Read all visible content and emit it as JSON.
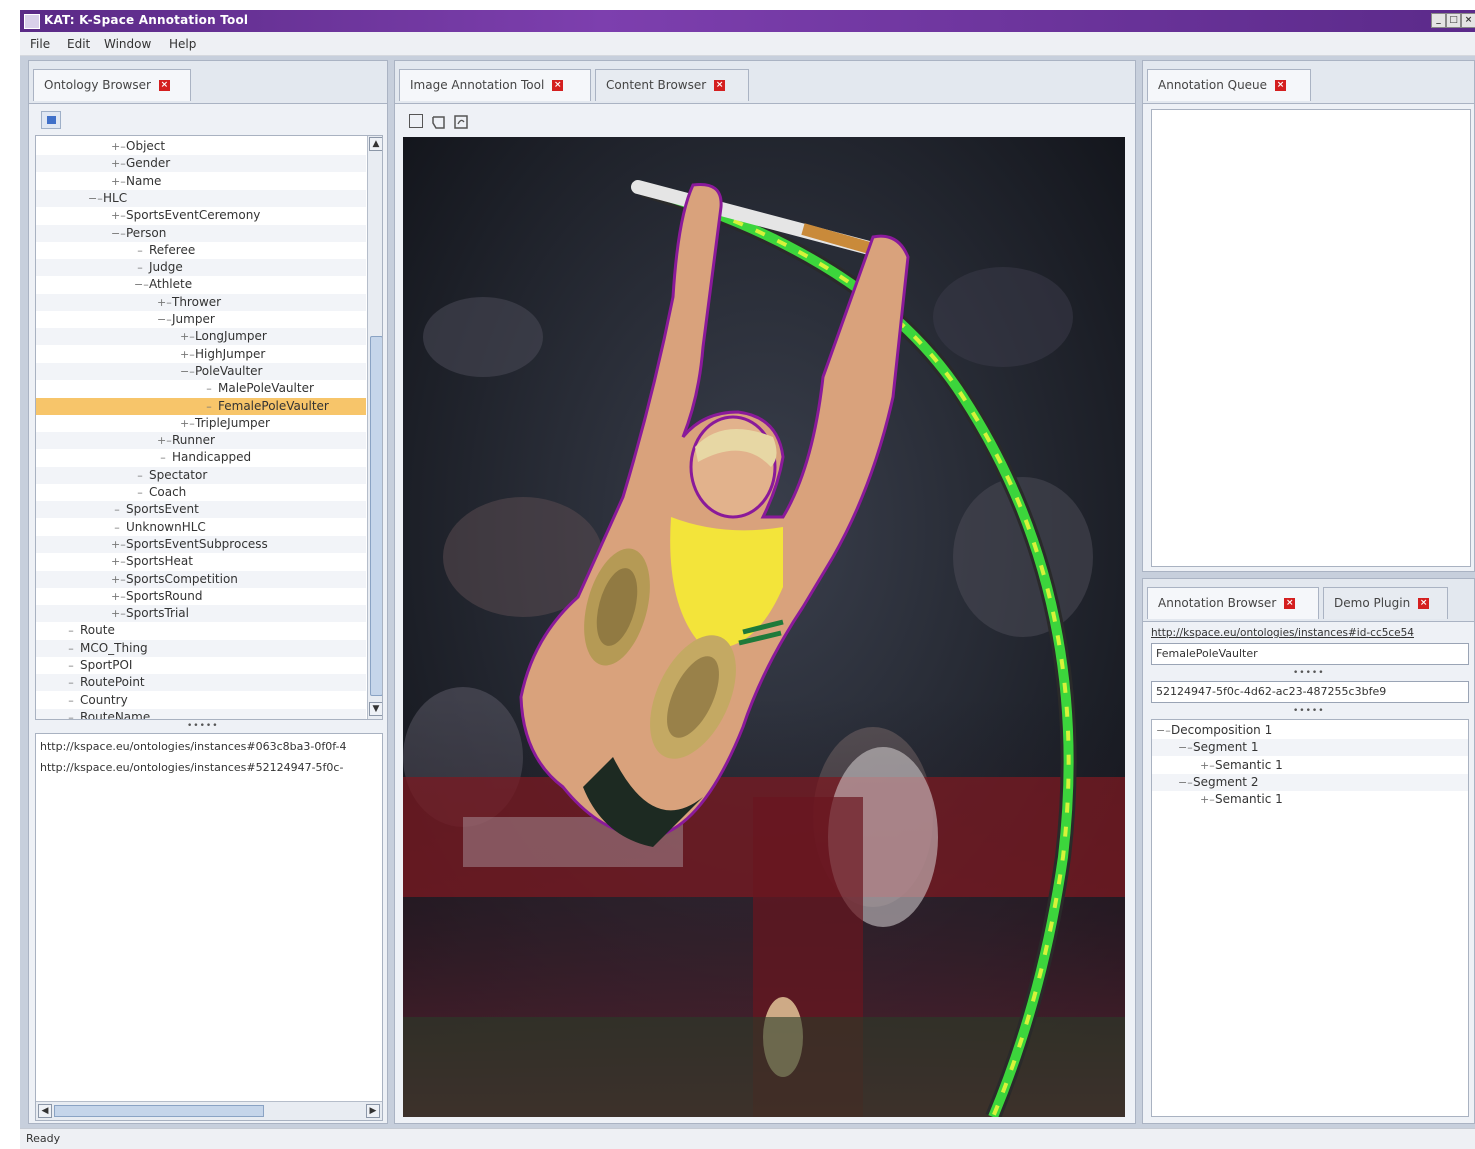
{
  "window": {
    "title": "KAT: K-Space Annotation Tool"
  },
  "menu": [
    "File",
    "Edit",
    "Window",
    "Help"
  ],
  "left_panel": {
    "tab_label": "Ontology Browser",
    "tree": [
      {
        "label": "Object",
        "depth": 3,
        "toggle": "+"
      },
      {
        "label": "Gender",
        "depth": 3,
        "toggle": "+"
      },
      {
        "label": "Name",
        "depth": 3,
        "toggle": "+"
      },
      {
        "label": "HLC",
        "depth": 2,
        "toggle": "−"
      },
      {
        "label": "SportsEventCeremony",
        "depth": 3,
        "toggle": "+"
      },
      {
        "label": "Person",
        "depth": 3,
        "toggle": "−"
      },
      {
        "label": "Referee",
        "depth": 4,
        "toggle": ""
      },
      {
        "label": "Judge",
        "depth": 4,
        "toggle": ""
      },
      {
        "label": "Athlete",
        "depth": 4,
        "toggle": "−"
      },
      {
        "label": "Thrower",
        "depth": 5,
        "toggle": "+"
      },
      {
        "label": "Jumper",
        "depth": 5,
        "toggle": "−"
      },
      {
        "label": "LongJumper",
        "depth": 6,
        "toggle": "+"
      },
      {
        "label": "HighJumper",
        "depth": 6,
        "toggle": "+"
      },
      {
        "label": "PoleVaulter",
        "depth": 6,
        "toggle": "−"
      },
      {
        "label": "MalePoleVaulter",
        "depth": 7,
        "toggle": ""
      },
      {
        "label": "FemalePoleVaulter",
        "depth": 7,
        "toggle": "",
        "selected": true
      },
      {
        "label": "TripleJumper",
        "depth": 6,
        "toggle": "+"
      },
      {
        "label": "Runner",
        "depth": 5,
        "toggle": "+"
      },
      {
        "label": "Handicapped",
        "depth": 5,
        "toggle": ""
      },
      {
        "label": "Spectator",
        "depth": 4,
        "toggle": ""
      },
      {
        "label": "Coach",
        "depth": 4,
        "toggle": ""
      },
      {
        "label": "SportsEvent",
        "depth": 3,
        "toggle": ""
      },
      {
        "label": "UnknownHLC",
        "depth": 3,
        "toggle": ""
      },
      {
        "label": "SportsEventSubprocess",
        "depth": 3,
        "toggle": "+"
      },
      {
        "label": "SportsHeat",
        "depth": 3,
        "toggle": "+"
      },
      {
        "label": "SportsCompetition",
        "depth": 3,
        "toggle": "+"
      },
      {
        "label": "SportsRound",
        "depth": 3,
        "toggle": "+"
      },
      {
        "label": "SportsTrial",
        "depth": 3,
        "toggle": "+"
      },
      {
        "label": "Route",
        "depth": 1,
        "toggle": ""
      },
      {
        "label": "MCO_Thing",
        "depth": 1,
        "toggle": ""
      },
      {
        "label": "SportPOI",
        "depth": 1,
        "toggle": ""
      },
      {
        "label": "RoutePoint",
        "depth": 1,
        "toggle": ""
      },
      {
        "label": "Country",
        "depth": 1,
        "toggle": ""
      },
      {
        "label": "RouteName",
        "depth": 1,
        "toggle": ""
      }
    ],
    "splitter": "•••••",
    "instances": [
      "http://kspace.eu/ontologies/instances#063c8ba3-0f0f-4",
      "http://kspace.eu/ontologies/instances#52124947-5f0c-"
    ]
  },
  "center_panel": {
    "tabs": [
      {
        "label": "Image Annotation Tool",
        "active": true
      },
      {
        "label": "Content Browser",
        "active": false
      }
    ],
    "tools": [
      "rectangle-select-icon",
      "polygon-select-icon",
      "freehand-select-icon"
    ],
    "image_alt": "pole vaulter"
  },
  "right_top": {
    "tab_label": "Annotation Queue"
  },
  "right_bottom": {
    "tabs": [
      {
        "label": "Annotation Browser",
        "active": true
      },
      {
        "label": "Demo Plugin",
        "active": false
      }
    ],
    "uri": "http://kspace.eu/ontologies/instances#id-cc5ce54",
    "concept": "FemalePoleVaulter",
    "splitter": "•••••",
    "id": "52124947-5f0c-4d62-ac23-487255c3bfe9",
    "tree": [
      {
        "label": "Decomposition 1",
        "depth": 0,
        "toggle": "−"
      },
      {
        "label": "Segment 1",
        "depth": 1,
        "toggle": "−"
      },
      {
        "label": "Semantic 1",
        "depth": 2,
        "toggle": "+"
      },
      {
        "label": "Segment 2",
        "depth": 1,
        "toggle": "−"
      },
      {
        "label": "Semantic 1",
        "depth": 2,
        "toggle": "+"
      }
    ]
  },
  "status": {
    "text": "Ready"
  },
  "colors": {
    "title_bar": "#5a2a86",
    "selection": "#f7c56a",
    "close_x": "#d41f1f",
    "outline": "#8a1a9a",
    "pole_mask": "#3cd53c"
  }
}
